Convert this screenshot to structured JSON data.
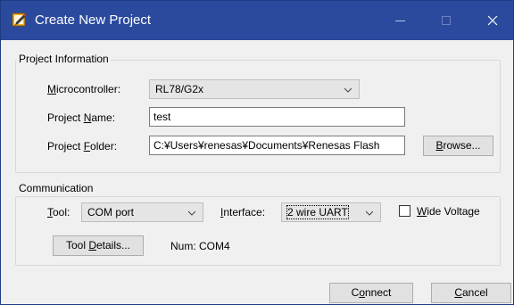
{
  "window": {
    "title": "Create New Project",
    "accent": "#2b4a9e"
  },
  "project_info": {
    "group_title": "Project Information",
    "microcontroller": {
      "label_prefix": "",
      "label_underline": "M",
      "label_rest": "icrocontroller:",
      "value": "RL78/G2x"
    },
    "project_name": {
      "label_prefix": "Project ",
      "label_underline": "N",
      "label_rest": "ame:",
      "value": "test"
    },
    "project_folder": {
      "label_prefix": "Project ",
      "label_underline": "F",
      "label_rest": "older:",
      "value": "C:¥Users¥renesas¥Documents¥Renesas Flash"
    },
    "browse_button": {
      "prefix": "",
      "underline": "B",
      "rest": "rowse..."
    }
  },
  "communication": {
    "group_title": "Communication",
    "tool": {
      "label_underline": "T",
      "label_rest": "ool:",
      "value": "COM port"
    },
    "interface": {
      "label_underline": "I",
      "label_rest": "nterface:",
      "value": "2 wire UART"
    },
    "wide_voltage": {
      "underline": "W",
      "rest": "ide Voltage",
      "checked": false
    },
    "tool_details_button": {
      "prefix": "Tool ",
      "underline": "D",
      "rest": "etails..."
    },
    "num": "Num: COM4"
  },
  "footer": {
    "connect": {
      "prefix": "C",
      "underline": "o",
      "rest": "nnect"
    },
    "cancel": {
      "prefix": "",
      "underline": "C",
      "rest": "ancel"
    }
  }
}
